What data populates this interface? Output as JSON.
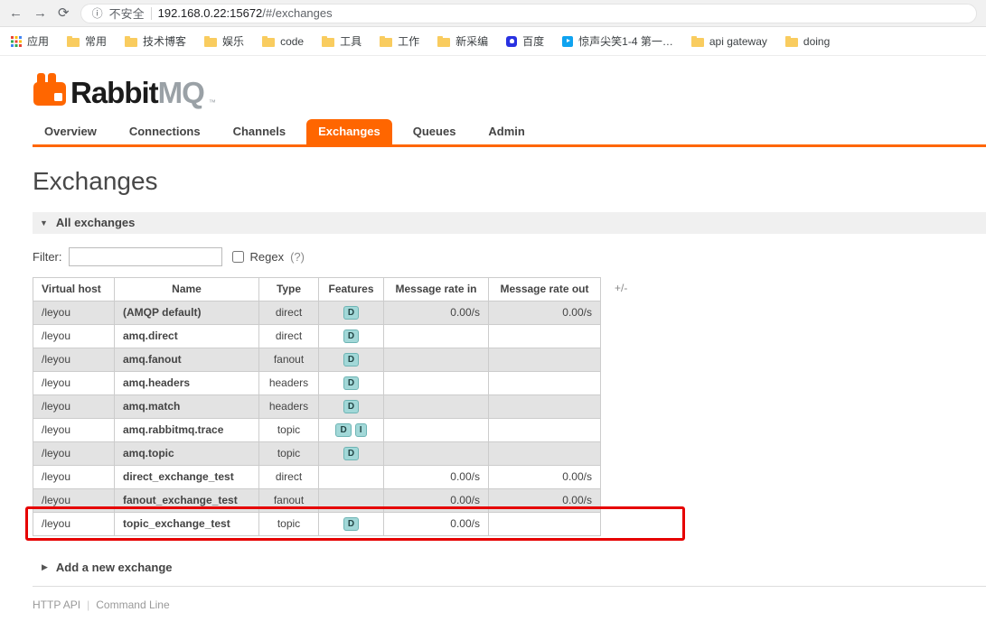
{
  "colors": {
    "accent_orange": "#ff6600",
    "highlight_red": "#e60000",
    "feature_badge_bg": "#a2d8d8",
    "row_stripe_gray": "#e3e3e3"
  },
  "browser": {
    "security_label": "不安全",
    "url_host": "192.168.0.22:15672",
    "url_path": "/#/exchanges",
    "bookmarks": [
      {
        "label": "应用",
        "icon": "apps-grid-icon"
      },
      {
        "label": "常用",
        "icon": "folder-icon"
      },
      {
        "label": "技术博客",
        "icon": "folder-icon"
      },
      {
        "label": "娱乐",
        "icon": "folder-icon"
      },
      {
        "label": "code",
        "icon": "folder-icon"
      },
      {
        "label": "工具",
        "icon": "folder-icon"
      },
      {
        "label": "工作",
        "icon": "folder-icon"
      },
      {
        "label": "新采编",
        "icon": "folder-icon"
      },
      {
        "label": "百度",
        "icon": "baidu-icon"
      },
      {
        "label": "惊声尖笑1-4 第一…",
        "icon": "video-site-icon"
      },
      {
        "label": "api gateway",
        "icon": "folder-icon"
      },
      {
        "label": "doing",
        "icon": "folder-icon"
      }
    ]
  },
  "app": {
    "logo": {
      "text_primary": "Rabbit",
      "text_secondary": "MQ",
      "tm": "™"
    },
    "nav": [
      "Overview",
      "Connections",
      "Channels",
      "Exchanges",
      "Queues",
      "Admin"
    ],
    "active_tab": "Exchanges",
    "page_title": "Exchanges",
    "sections": {
      "all_exchanges": "All exchanges",
      "add_exchange": "Add a new exchange"
    },
    "filter": {
      "label": "Filter:",
      "value": "",
      "regex_label": "Regex",
      "regex_help": "(?)",
      "regex_checked": false
    },
    "table": {
      "headers": [
        "Virtual host",
        "Name",
        "Type",
        "Features",
        "Message rate in",
        "Message rate out"
      ],
      "plus_minus_label": "+/-",
      "rows": [
        {
          "vhost": "/leyou",
          "name": "(AMQP default)",
          "type": "direct",
          "features": [
            "D"
          ],
          "rate_in": "0.00/s",
          "rate_out": "0.00/s",
          "highlighted": false
        },
        {
          "vhost": "/leyou",
          "name": "amq.direct",
          "type": "direct",
          "features": [
            "D"
          ],
          "rate_in": "",
          "rate_out": "",
          "highlighted": false
        },
        {
          "vhost": "/leyou",
          "name": "amq.fanout",
          "type": "fanout",
          "features": [
            "D"
          ],
          "rate_in": "",
          "rate_out": "",
          "highlighted": false
        },
        {
          "vhost": "/leyou",
          "name": "amq.headers",
          "type": "headers",
          "features": [
            "D"
          ],
          "rate_in": "",
          "rate_out": "",
          "highlighted": false
        },
        {
          "vhost": "/leyou",
          "name": "amq.match",
          "type": "headers",
          "features": [
            "D"
          ],
          "rate_in": "",
          "rate_out": "",
          "highlighted": false
        },
        {
          "vhost": "/leyou",
          "name": "amq.rabbitmq.trace",
          "type": "topic",
          "features": [
            "D",
            "I"
          ],
          "rate_in": "",
          "rate_out": "",
          "highlighted": false
        },
        {
          "vhost": "/leyou",
          "name": "amq.topic",
          "type": "topic",
          "features": [
            "D"
          ],
          "rate_in": "",
          "rate_out": "",
          "highlighted": false
        },
        {
          "vhost": "/leyou",
          "name": "direct_exchange_test",
          "type": "direct",
          "features": [],
          "rate_in": "0.00/s",
          "rate_out": "0.00/s",
          "highlighted": false
        },
        {
          "vhost": "/leyou",
          "name": "fanout_exchange_test",
          "type": "fanout",
          "features": [],
          "rate_in": "0.00/s",
          "rate_out": "0.00/s",
          "highlighted": false
        },
        {
          "vhost": "/leyou",
          "name": "topic_exchange_test",
          "type": "topic",
          "features": [
            "D"
          ],
          "rate_in": "0.00/s",
          "rate_out": "",
          "highlighted": true
        }
      ]
    },
    "footer": {
      "links": [
        "HTTP API",
        "Command Line"
      ],
      "separator": "|"
    }
  }
}
